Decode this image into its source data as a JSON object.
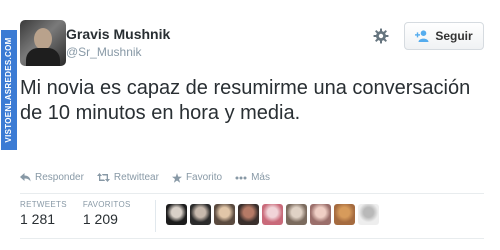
{
  "watermark": {
    "text": "VISTOENLASREDES.COM"
  },
  "user": {
    "display_name": "Gravis Mushnik",
    "handle": "@Sr_Mushnik"
  },
  "header": {
    "follow_label": "Seguir",
    "settings_icon": "gear-icon",
    "follow_icon": "add-user-icon"
  },
  "tweet": {
    "text": "Mi novia es capaz de resumirme una conversación de 10 minutos en hora y media."
  },
  "actions": [
    {
      "label": "Responder",
      "icon": "reply-icon"
    },
    {
      "label": "Retwittear",
      "icon": "retweet-icon"
    },
    {
      "label": "Favorito",
      "icon": "star-icon"
    },
    {
      "label": "Más",
      "icon": "more-icon"
    }
  ],
  "stats": {
    "retweets_label": "RETWEETS",
    "retweets_value": "1 281",
    "favorites_label": "FAVORITOS",
    "favorites_value": "1 209"
  },
  "favoriters": [
    {
      "color": "#1c1c1c",
      "accent": "#d8d0c8"
    },
    {
      "color": "#2b2b2b",
      "accent": "#c7b9ad"
    },
    {
      "color": "#5a4a3f",
      "accent": "#e1c6a8"
    },
    {
      "color": "#3a2f2c",
      "accent": "#b57a66"
    },
    {
      "color": "#c96a7a",
      "accent": "#f1d4d8"
    },
    {
      "color": "#7b6b5e",
      "accent": "#e0d2c5"
    },
    {
      "color": "#9b6f6b",
      "accent": "#f0cfc5"
    },
    {
      "color": "#a56b3f",
      "accent": "#d79b5b"
    },
    {
      "color": "#eeeeee",
      "accent": "#b9b9b9"
    }
  ],
  "colors": {
    "text": "#292f33",
    "muted": "#8899a6",
    "watermark": "#3b7bd4",
    "follow_icon": "#55acee"
  }
}
